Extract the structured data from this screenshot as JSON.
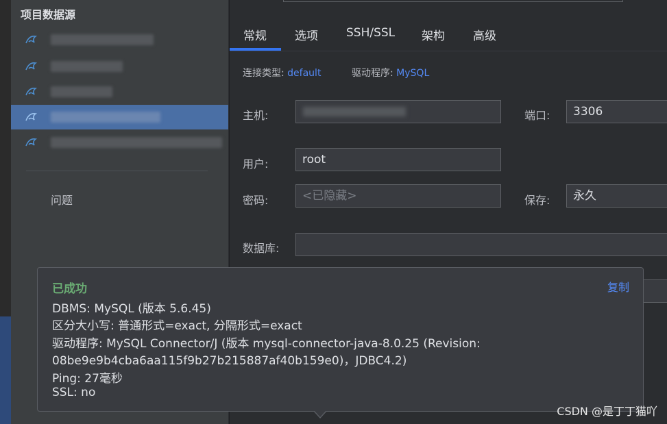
{
  "sidebar": {
    "title": "项目数据源",
    "problems_label": "问题"
  },
  "tabs": [
    {
      "label": "常规",
      "active": true
    },
    {
      "label": "选项"
    },
    {
      "label": "SSH/SSL"
    },
    {
      "label": "架构"
    },
    {
      "label": "高级"
    }
  ],
  "connection": {
    "type_label": "连接类型:",
    "type_value": "default",
    "driver_label": "驱动程序:",
    "driver_value": "MySQL"
  },
  "form": {
    "host_label": "主机:",
    "port_label": "端口:",
    "port_value": "3306",
    "user_label": "用户:",
    "user_value": "root",
    "password_label": "密码:",
    "password_placeholder": "<已隐藏>",
    "save_label": "保存:",
    "save_value": "永久",
    "database_label": "数据库:"
  },
  "popup": {
    "title": "已成功",
    "copy_label": "复制",
    "lines": [
      "DBMS: MySQL (版本 5.6.45)",
      "区分大小写: 普通形式=exact, 分隔形式=exact",
      "驱动程序: MySQL Connector/J (版本 mysql-connector-java-8.0.25 (Revision:",
      "08be9e9b4cba6aa115f9b27b215887af40b159e0)，JDBC4.2)",
      "Ping: 27毫秒",
      "SSL: no"
    ]
  },
  "watermark": "CSDN @是丁丁猫吖",
  "colors": {
    "accent": "#3574f0",
    "link": "#548af7",
    "success": "#6aab73",
    "selection": "#4a6fa5"
  }
}
